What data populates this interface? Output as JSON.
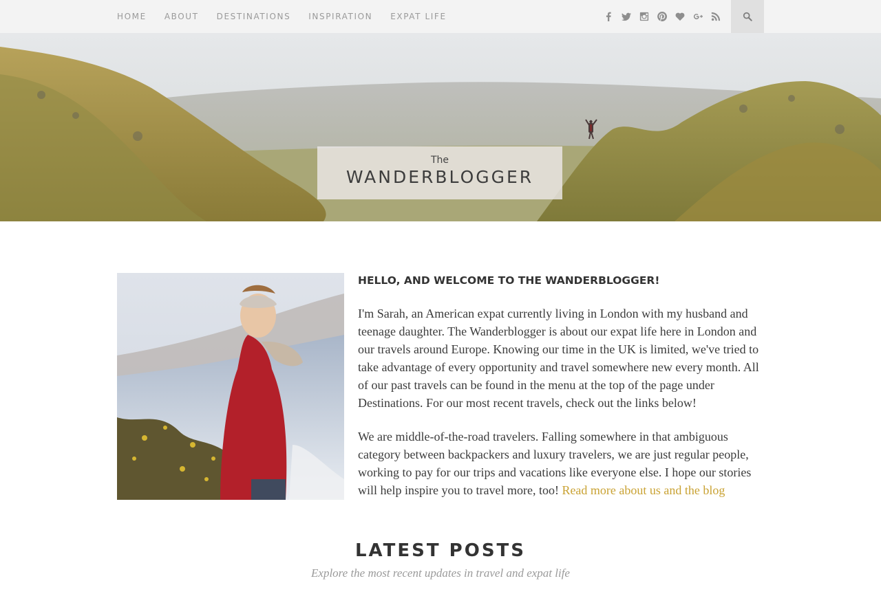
{
  "nav": {
    "items": [
      "HOME",
      "ABOUT",
      "DESTINATIONS",
      "INSPIRATION",
      "EXPAT LIFE"
    ],
    "social_icons": [
      "facebook-icon",
      "twitter-icon",
      "instagram-icon",
      "pinterest-icon",
      "bloglovin-heart-icon",
      "google-plus-icon",
      "rss-icon"
    ],
    "search_icon": "search-icon"
  },
  "hero": {
    "logo_the": "The",
    "logo_main": "WANDERBLOGGER"
  },
  "about": {
    "heading": "HELLO, AND WELCOME TO THE WANDERBLOGGER!",
    "paragraph1": "I'm Sarah, an American expat currently living in London with my husband and teenage daughter. The Wanderblogger is about our expat life here in London and our travels around Europe. Knowing our time in the UK is limited, we've tried to take advantage of every opportunity and travel somewhere new every month. All of our past travels can be found in the menu at the top of the page under Destinations. For our most recent travels, check out the links below!",
    "paragraph2": "We are middle-of-the-road travelers. Falling somewhere in that ambiguous category between backpackers and luxury travelers, we are just regular people, working to pay for our trips and vacations like everyone else. I hope our stories will help inspire you to travel more, too!",
    "read_more": "Read more about us and the blog"
  },
  "latest": {
    "title": "LATEST POSTS",
    "subtitle": "Explore the most recent updates in travel and expat life"
  },
  "colors": {
    "nav_bg": "#f3f3f3",
    "nav_text": "#9a9a9a",
    "accent_link": "#c9a233",
    "body_text": "#3b3b3b"
  }
}
